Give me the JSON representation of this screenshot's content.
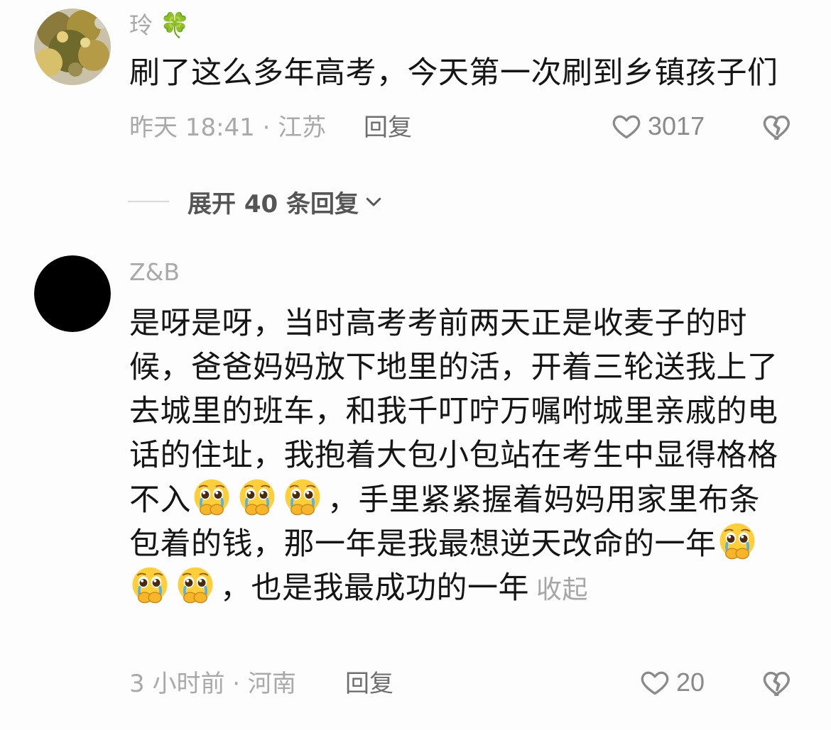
{
  "comments": [
    {
      "username": "玲",
      "username_emoji": "🍀",
      "text_lines": [
        "刷了这么多年高考，今天第一次刷到乡镇孩子们"
      ],
      "time": "昨天 18:41 · 江苏",
      "reply_label": "回复",
      "like_count": "3017"
    },
    {
      "username": "Z&B",
      "line1": "是呀是呀，当时高考考前两天正是收麦子的时",
      "line2": "候，爸爸妈妈放下地里的活，开着三轮送我上了",
      "line3": "去城里的班车，和我千叮咛万嘱咐城里亲戚的电",
      "line4": "话的住址，我抱着大包小包站在考生中显得格格",
      "line5_start": "不入",
      "line5_end": "，手里紧紧握着妈妈用家里布条",
      "line6": "包着的钱，那一年是我最想逆天改命的一年",
      "line7_end": "，也是我最成功的一年",
      "collapse_label": "收起",
      "time": "3 小时前 · 河南",
      "reply_label": "回复",
      "like_count": "20"
    }
  ],
  "expand": {
    "label": "展开 40 条回复"
  },
  "icons": {
    "like": "heart-outline-icon",
    "dislike": "broken-heart-icon",
    "emoji": "pleading-crying-face-emoji",
    "chevron": "chevron-down-icon"
  },
  "colors": {
    "background": "#fdfdfd",
    "text": "#151515",
    "muted": "#a9a9a9",
    "emoji_face": "#ffcf3a"
  }
}
